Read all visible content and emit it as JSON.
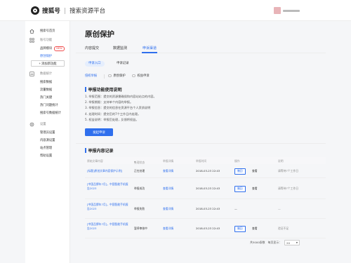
{
  "header": {
    "brand": "搜狐号",
    "subtitle": "搜索资源平台"
  },
  "sidebar": {
    "items": [
      {
        "label": "搜索号首页",
        "icon": "home-icon"
      },
      {
        "label": "账号功能",
        "icon": "grid-icon"
      }
    ],
    "account_subs": [
      {
        "label": "品牌模块",
        "badge": "NEW"
      },
      {
        "label": "原创保护"
      }
    ],
    "add_button": "+ 添加新功能",
    "data_group": {
      "label": "数据统计",
      "icon": "chart-icon"
    },
    "data_subs": [
      "搜索数据",
      "流量数据",
      "热门关键",
      "热门问题统计",
      "搜索号数据统计"
    ],
    "tools_group": {
      "label": "设置",
      "icon": "settings-icon"
    },
    "tools_subs": [
      "管理员设置",
      "内容源设置",
      "站点管理",
      "帮助设置"
    ]
  },
  "main": {
    "title": "原创保护",
    "tabs": [
      "内容提交",
      "数据监测",
      "申诉渠道"
    ],
    "active_tab": 2,
    "subtabs": [
      "申诉入口",
      "申诉记录"
    ],
    "filters": [
      "侵权举报",
      "原创保护",
      "权益申诉"
    ],
    "instructions_title": "举报功能使用说明",
    "instructions": [
      "1. 举报范围：提交的资源需确保和内容站站点的内容。",
      "2. 举报期限：支持单个内容的举报。",
      "3. 举报信息：提交的信息在资源平台个人资质说明",
      "4. 处理时间：提交后的7个工作日内处理。",
      "5. 权益说明：举报后处理，反馈将权益。"
    ],
    "submit_button": "发起申诉",
    "records_title": "举报内容记录",
    "table": {
      "headers": [
        "原始文章内容",
        "处理状态",
        "举报详情",
        "举报时间",
        "操作",
        "说明"
      ],
      "rows": [
        {
          "title": "[标题]原创文章内容保护示例]",
          "status": "正在处理",
          "detail": "查看详情",
          "time": "2018-03-23 22:43",
          "op1": "撤回",
          "op2": "查看",
          "note": "请等待7个工作日"
        },
        {
          "title": "[中国品牌年7月]，中国智能手机报告2023",
          "status": "举报成功",
          "detail": "查看详情",
          "time": "2018-03-23 22:43",
          "op1": "撤回",
          "op2": "查看",
          "note": "请等待7个工作日"
        },
        {
          "title": "[中国品牌年7月]，中国智能手机报告2023",
          "status": "举报失败",
          "detail": "查看详情",
          "time": "2018-03-23 22:43",
          "op1": "—",
          "op2": "",
          "note": "—"
        },
        {
          "title": "[中国品牌年7月]，中国智能手机报告2023",
          "status": "暂停审核中",
          "detail": "查看详情",
          "time": "2018-03-23 22:43",
          "op1": "撤回",
          "op2": "查看",
          "note": "验证不足"
        }
      ]
    },
    "pager": {
      "total": "共5000条数",
      "size_label": "每页显示：",
      "size_value": "20"
    }
  }
}
